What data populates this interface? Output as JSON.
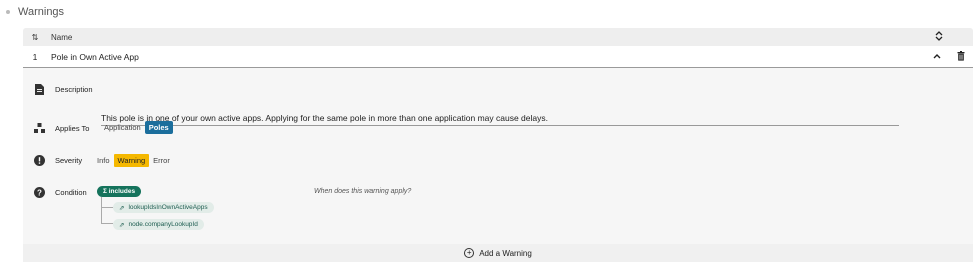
{
  "section": {
    "title": "Warnings"
  },
  "table": {
    "header_name": "Name",
    "rows": [
      {
        "number": "1",
        "title": "Pole in Own Active App"
      }
    ]
  },
  "detail": {
    "description": {
      "label": "Description",
      "value": "This pole is in one of your own active apps. Applying for the same pole in more than one application may cause delays."
    },
    "applies_to": {
      "label": "Applies To",
      "options": [
        "Application",
        "Poles"
      ],
      "selected": "Poles"
    },
    "severity": {
      "label": "Severity",
      "options": [
        "Info",
        "Warning",
        "Error"
      ],
      "selected": "Warning"
    },
    "condition": {
      "label": "Condition",
      "operator": "Σ  includes",
      "operands": [
        "lookupIdsInOwnActiveApps",
        "node.companyLookupId"
      ],
      "hint": "When does this warning apply?"
    }
  },
  "footer": {
    "add_label": "Add a Warning"
  },
  "colors": {
    "accent_blue": "#1b6e9c",
    "warning_yellow": "#f5b800",
    "condition_green": "#15735c"
  }
}
